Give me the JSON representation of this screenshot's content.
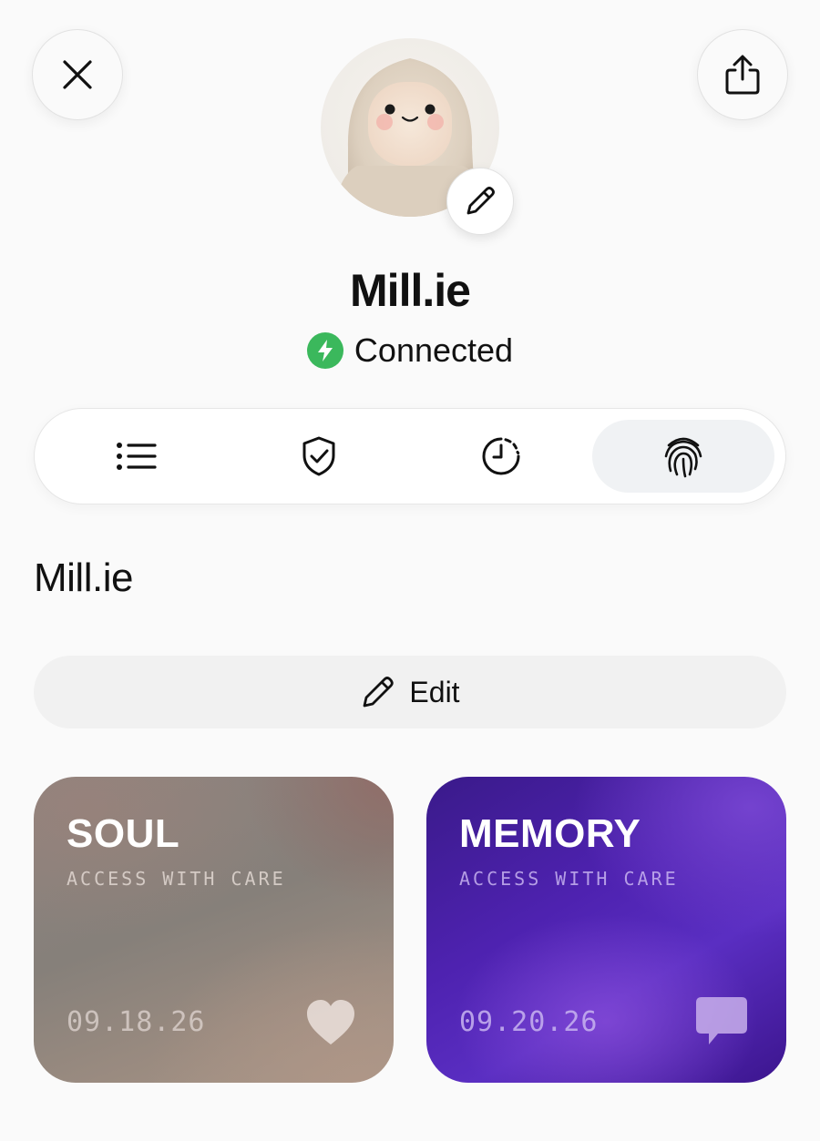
{
  "profile": {
    "name": "Mill.ie",
    "status": "Connected",
    "status_color": "#3bb85c"
  },
  "tabs": [
    {
      "icon": "list-icon",
      "active": false
    },
    {
      "icon": "shield-check-icon",
      "active": false
    },
    {
      "icon": "clock-dashed-icon",
      "active": false
    },
    {
      "icon": "fingerprint-icon",
      "active": true
    }
  ],
  "section": {
    "name": "Mill.ie",
    "edit_label": "Edit"
  },
  "cards": [
    {
      "title": "SOUL",
      "subtitle": "ACCESS WITH CARE",
      "date": "09.18.26",
      "icon": "heart-icon"
    },
    {
      "title": "MEMORY",
      "subtitle": "ACCESS WITH CARE",
      "date": "09.20.26",
      "icon": "chat-bubble-icon"
    }
  ],
  "icons": {
    "close": "close-icon",
    "share": "share-icon",
    "avatar_edit": "pencil-icon",
    "status": "lightning-icon"
  }
}
